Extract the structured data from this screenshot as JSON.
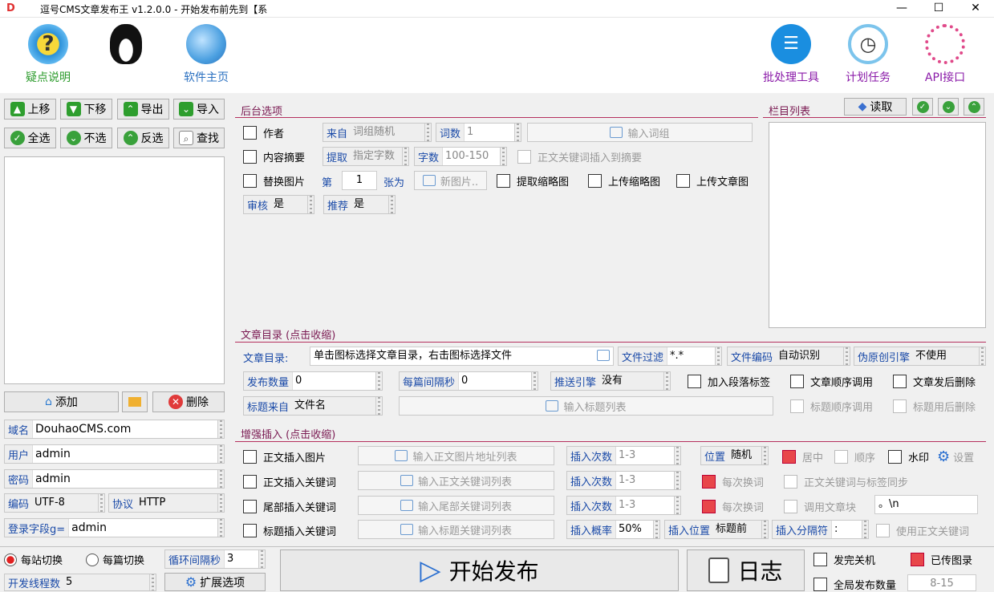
{
  "window": {
    "title": "逗号CMS文章发布王 v1.2.0.0 - 开始发布前先到【系",
    "minimize": "—",
    "maximize": "☐",
    "close": "✕"
  },
  "toolbar": {
    "help_label": "疑点说明",
    "qq_label": "",
    "home_label": "软件主页",
    "batch_label": "批处理工具",
    "schedule_label": "计划任务",
    "api_label": "API接口"
  },
  "left": {
    "move_up": "上移",
    "move_down": "下移",
    "export": "导出",
    "import": "导入",
    "select_all": "全选",
    "select_none": "不选",
    "invert": "反选",
    "find": "查找",
    "add": "添加",
    "delete": "删除",
    "fields": [
      {
        "key": "域名",
        "value": "DouhaoCMS.com"
      },
      {
        "key": "用户",
        "value": "admin"
      },
      {
        "key": "密码",
        "value": "admin"
      }
    ],
    "encoding_key": "编码",
    "encoding_value": "UTF-8",
    "protocol_key": "协议",
    "protocol_value": "HTTP",
    "login_key": "登录字段g=",
    "login_value": "admin"
  },
  "backend": {
    "title": "后台选项",
    "author": "作者",
    "source_key": "来自",
    "source_value": "词组随机",
    "wordcount_key": "词数",
    "wordcount_value": "1",
    "input_words": "输入词组",
    "summary": "内容摘要",
    "extract_key": "提取",
    "extract_value": "指定字数",
    "chars_key": "字数",
    "chars_value": "100-150",
    "keyword_summary": "正文关键词插入到摘要",
    "replace_img": "替换图片",
    "nth": "第",
    "nth_value": "1",
    "per_img": "张为",
    "new_img": "新图片..",
    "extract_thumb": "提取缩略图",
    "upload_thumb": "上传缩略图",
    "upload_article_img": "上传文章图",
    "audit_key": "审核",
    "audit_value": "是",
    "recommend_key": "推荐",
    "recommend_value": "是"
  },
  "column": {
    "title": "栏目列表",
    "read": "读取"
  },
  "article_dir": {
    "title": "文章目录 (点击收缩)",
    "dir_label": "文章目录:",
    "dir_value": "单击图标选择文章目录，右击图标选择文件",
    "filter_key": "文件过滤",
    "filter_value": "*.*",
    "encoding_key": "文件编码",
    "encoding_value": "自动识别",
    "pseudo_key": "伪原创引擎",
    "pseudo_value": "不使用",
    "publish_count_key": "发布数量",
    "publish_count_value": "0",
    "interval_key": "每篇间隔秒",
    "interval_value": "0",
    "push_key": "推送引擎",
    "push_value": "没有",
    "add_para_tag": "加入段落标签",
    "sequential": "文章顺序调用",
    "delete_after": "文章发后删除",
    "title_src_key": "标题来自",
    "title_src_value": "文件名",
    "input_titles": "输入标题列表",
    "title_sequential": "标题顺序调用",
    "title_delete_after": "标题用后删除"
  },
  "enhance": {
    "title": "增强插入 (点击收缩)",
    "rows": [
      {
        "check": "正文插入图片",
        "btn": "输入正文图片地址列表",
        "k": "插入次数",
        "v": "1-3"
      },
      {
        "check": "正文插入关键词",
        "btn": "输入正文关键词列表",
        "k": "插入次数",
        "v": "1-3"
      },
      {
        "check": "尾部插入关键词",
        "btn": "输入尾部关键词列表",
        "k": "插入次数",
        "v": "1-3"
      },
      {
        "check": "标题插入关键词",
        "btn": "输入标题关键词列表",
        "k": "插入概率",
        "v": "50%"
      }
    ],
    "position_key": "位置",
    "position_value": "随机",
    "center": "居中",
    "order": "顺序",
    "watermark": "水印",
    "settings": "设置",
    "each_change": "每次换词",
    "sync_keywords": "正文关键词与标签同步",
    "each_change2": "每次换词",
    "call_block": "调用文章块",
    "block_value": "。\\n",
    "insert_pos_key": "插入位置",
    "insert_pos_value": "标题前",
    "insert_sep_key": "插入分隔符",
    "insert_sep_value": ":",
    "use_body_kw": "使用正文关键词"
  },
  "bottom": {
    "per_site": "每站切换",
    "per_article": "每篇切换",
    "loop_key": "循环间隔秒",
    "loop_value": "3",
    "threads_key": "开发线程数",
    "threads_value": "5",
    "expand": "扩展选项",
    "start": "开始发布",
    "log": "日志",
    "shutdown": "发完关机",
    "posted_tags": "已传图录",
    "global_count": "全局发布数量",
    "global_value": "8-15"
  },
  "colors": {
    "accent": "#b5305e",
    "blue_label": "#1a4aa8",
    "start_arrow": "#2a6fd0"
  }
}
